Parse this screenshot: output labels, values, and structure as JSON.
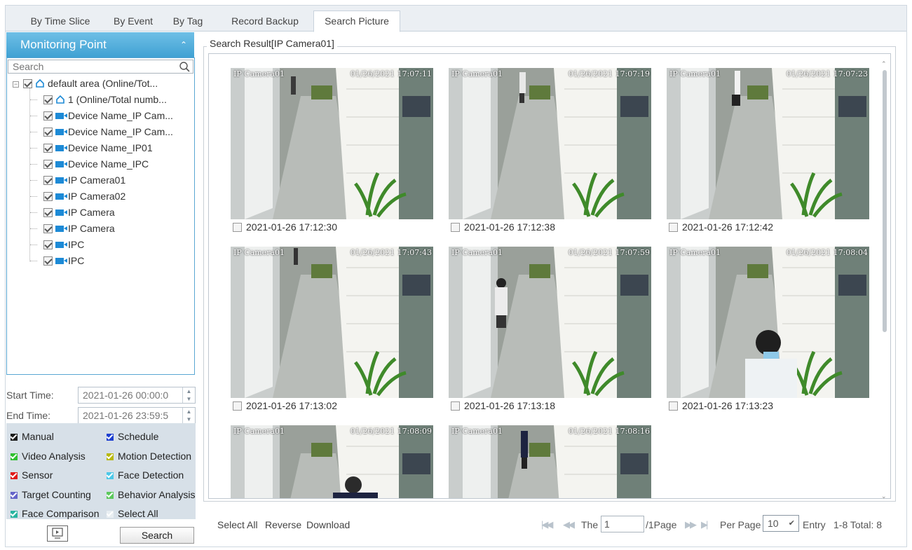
{
  "tabs": [
    {
      "label": "By Time Slice",
      "active": false
    },
    {
      "label": "By Event",
      "active": false
    },
    {
      "label": "By Tag",
      "active": false
    },
    {
      "label": "Record Backup",
      "active": false
    },
    {
      "label": "Search Picture",
      "active": true
    }
  ],
  "left": {
    "header": "Monitoring Point",
    "search_placeholder": "Search",
    "tree": [
      "default area (Online/Tot...",
      "1 (Online/Total numb...",
      "Device Name_IP Cam...",
      "Device Name_IP Cam...",
      "Device Name_IP01",
      "Device Name_IPC",
      "IP Camera01",
      "IP Camera02",
      "IP Camera",
      "IP Camera",
      "IPC",
      "IPC"
    ],
    "start_label": "Start Time:",
    "start_value": "2021-01-26 00:00:0",
    "end_label": "End Time:",
    "end_value": "2021-01-26 23:59:5",
    "types": [
      {
        "label": "Manual",
        "color": "#1a1a1a"
      },
      {
        "label": "Schedule",
        "color": "#1e3fd0"
      },
      {
        "label": "Video Analysis",
        "color": "#2fbf2f"
      },
      {
        "label": "Motion Detection",
        "color": "#b8b80c"
      },
      {
        "label": "Sensor",
        "color": "#e01818"
      },
      {
        "label": "Face Detection",
        "color": "#4cc8e8"
      },
      {
        "label": "Target Counting",
        "color": "#6464c8"
      },
      {
        "label": "Behavior Analysis",
        "color": "#5cc85c"
      },
      {
        "label": "Face Comparison",
        "color": "#28b4a0"
      },
      {
        "label": "Select All",
        "color": "#e8eef2"
      }
    ],
    "search_button": "Search"
  },
  "results": {
    "title": "Search Result[IP Camera01]",
    "items": [
      {
        "osd_name": "IP Camera01",
        "osd_time": "01/26/2021 17:07:11",
        "caption": "2021-01-26 17:12:30"
      },
      {
        "osd_name": "IP Camera01",
        "osd_time": "01/26/2021 17:07:19",
        "caption": "2021-01-26 17:12:38"
      },
      {
        "osd_name": "IP Camera01",
        "osd_time": "01/26/2021 17:07:23",
        "caption": "2021-01-26 17:12:42"
      },
      {
        "osd_name": "IP Camera01",
        "osd_time": "01/26/2021 17:07:43",
        "caption": "2021-01-26 17:13:02"
      },
      {
        "osd_name": "IP Camera01",
        "osd_time": "01/26/2021 17:07:59",
        "caption": "2021-01-26 17:13:18"
      },
      {
        "osd_name": "IP Camera01",
        "osd_time": "01/26/2021 17:08:04",
        "caption": "2021-01-26 17:13:23"
      },
      {
        "osd_name": "IP Camera01",
        "osd_time": "01/26/2021 17:08:09",
        "caption": ""
      },
      {
        "osd_name": "IP Camera01",
        "osd_time": "01/26/2021 17:08:16",
        "caption": ""
      }
    ]
  },
  "footer": {
    "select_all": "Select All",
    "reverse": "Reverse",
    "download": "Download",
    "the": "The",
    "page_value": "1",
    "page_total": "/1Page",
    "per_page": "Per Page",
    "per_page_value": "10",
    "entry": "Entry",
    "range": "1-8 Total: 8"
  }
}
